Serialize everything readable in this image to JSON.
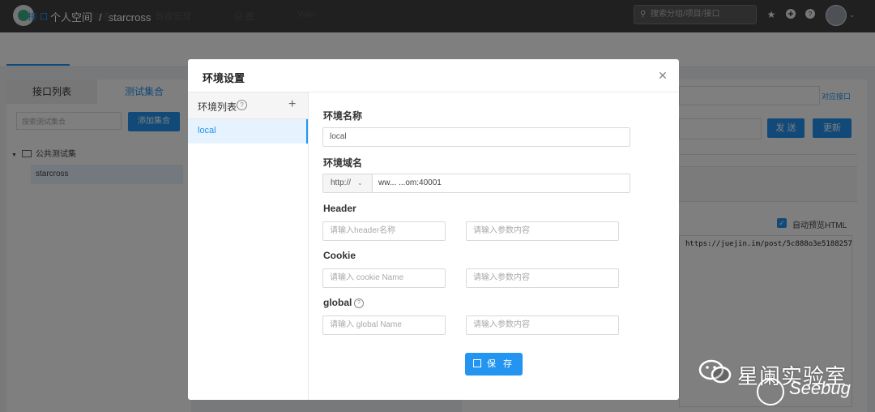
{
  "header": {
    "breadcrumb_group": "个人空间",
    "breadcrumb_sep": "/",
    "breadcrumb_project": "starcross",
    "search_placeholder": "搜索分组/项目/接口",
    "icons": [
      "star-icon",
      "plus-circle-icon",
      "help-icon",
      "avatar",
      "chevron-down-icon"
    ]
  },
  "nav_tabs": [
    "接 口",
    "动 态",
    "数据管理",
    "设 置",
    "Wiki"
  ],
  "left_panel": {
    "tab_interfaces": "接口列表",
    "tab_collections": "测试集合",
    "search_placeholder": "搜索测试集合",
    "add_button": "添加集合",
    "tree_folder": "公共测试集",
    "tree_item": "starcross"
  },
  "right_panel": {
    "link": "对应接口",
    "send_button": "发 送",
    "update_button": "更新",
    "auto_preview_label": "自动预览HTML",
    "auto_preview_checked": true,
    "url_text": "https://juejin.im/post/5c888o3e5188257"
  },
  "modal": {
    "title": "环境设置",
    "env_list_header": "环境列表",
    "env_items": [
      "local"
    ],
    "selected_env": "local",
    "fields": {
      "env_name_label": "环境名称",
      "env_name_value": "local",
      "env_domain_label": "环境域名",
      "protocol_value": "http://",
      "domain_value": "ww...          ...om:40001",
      "header_label": "Header",
      "header_name_placeholder": "请输入header名称",
      "header_value_placeholder": "请输入参数内容",
      "cookie_label": "Cookie",
      "cookie_name_placeholder": "请输入 cookie Name",
      "cookie_value_placeholder": "请输入参数内容",
      "global_label": "global",
      "global_name_placeholder": "请输入 global Name",
      "global_value_placeholder": "请输入参数内容"
    },
    "save_button": "保 存"
  },
  "watermark": {
    "title": "星阑实验室",
    "subtitle": "Seebug"
  },
  "colors": {
    "accent": "#2395f1",
    "topbar": "#404040",
    "selected_bg": "#e6f2fd"
  }
}
